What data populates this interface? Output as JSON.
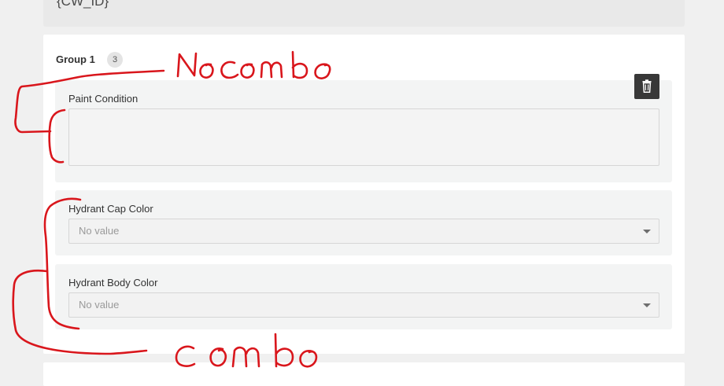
{
  "top_field": {
    "text": "{CW_ID}"
  },
  "group": {
    "title": "Group 1",
    "count": "3",
    "delete_icon": "trash-icon",
    "fields": {
      "paint_condition": {
        "label": "Paint Condition"
      },
      "hydrant_cap_color": {
        "label": "Hydrant Cap Color",
        "value": "No value"
      },
      "hydrant_body_color": {
        "label": "Hydrant Body Color",
        "value": "No value"
      }
    }
  },
  "annotations": {
    "top": "Nocombo",
    "bottom": "combo",
    "color": "#d9161c"
  },
  "colors": {
    "page_bg": "#f0f0f0",
    "card_bg": "#ffffff",
    "field_bg": "#f3f4f4",
    "button_bg": "#383838"
  }
}
